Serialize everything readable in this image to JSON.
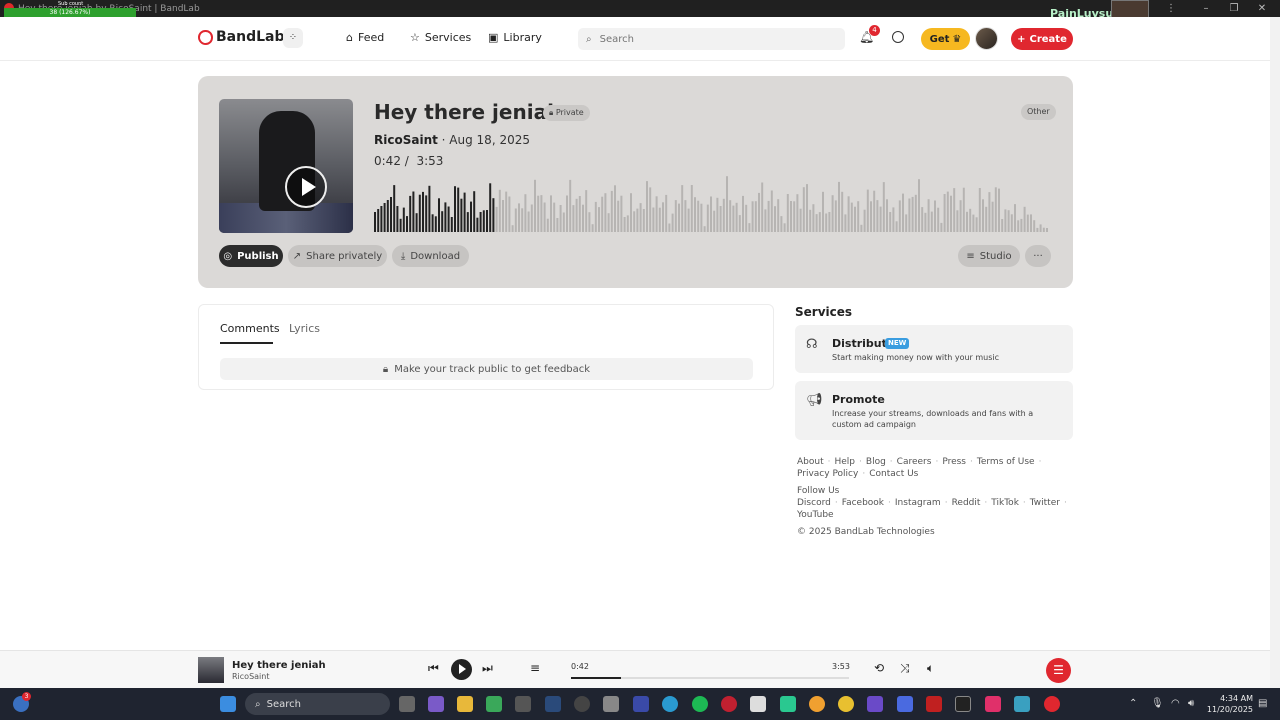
{
  "window": {
    "title": "Hey there jeniah by RicoSaint | BandLab",
    "overlay_top": "Sub count",
    "overlay_bar": "38 (126.67%)",
    "streamer_name": "PainLuvsu",
    "controls": [
      "–",
      "❐",
      "✕"
    ]
  },
  "header": {
    "logo": "BandLab",
    "nav": [
      "Feed",
      "Services",
      "Library"
    ],
    "search_placeholder": "Search",
    "notifications_count": "4",
    "get_label": "Get",
    "create_label": "Create"
  },
  "track": {
    "title": "Hey there jeniah",
    "visibility": "Private",
    "genre": "Other",
    "artist": "RicoSaint",
    "date": "· Aug 18, 2025",
    "current_time": "0:42",
    "duration": "3:53",
    "progress": 0.18,
    "buttons": {
      "publish": "Publish",
      "share": "Share privately",
      "download": "Download",
      "studio": "Studio",
      "more": "···"
    }
  },
  "comments": {
    "tabs": [
      "Comments",
      "Lyrics"
    ],
    "notice": "Make your track public to get feedback"
  },
  "services": {
    "title": "Services",
    "items": [
      {
        "name": "Distribute",
        "badge": "NEW",
        "desc": "Start making money now with your music"
      },
      {
        "name": "Promote",
        "badge": "",
        "desc": "Increase your streams, downloads and fans with a custom ad campaign"
      }
    ]
  },
  "footer": {
    "links1": [
      "About",
      "Help",
      "Blog",
      "Careers",
      "Press",
      "Terms of Use"
    ],
    "links2": [
      "Privacy Policy",
      "Contact Us"
    ],
    "follow": "Follow Us",
    "social1": [
      "Discord",
      "Facebook",
      "Instagram",
      "Reddit",
      "TikTok",
      "Twitter"
    ],
    "social2": [
      "YouTube"
    ],
    "copyright": "© 2025 BandLab Technologies"
  },
  "player": {
    "title": "Hey there jeniah",
    "artist": "RicoSaint",
    "current_time": "0:42",
    "duration": "3:53"
  },
  "taskbar": {
    "search": "Search",
    "time": "4:34 AM",
    "date": "11/20/2025",
    "notif_badge": "3"
  },
  "colors": {
    "brand": "#e0272f",
    "get": "#f6b820",
    "hero_bg": "#dbd9d7"
  }
}
